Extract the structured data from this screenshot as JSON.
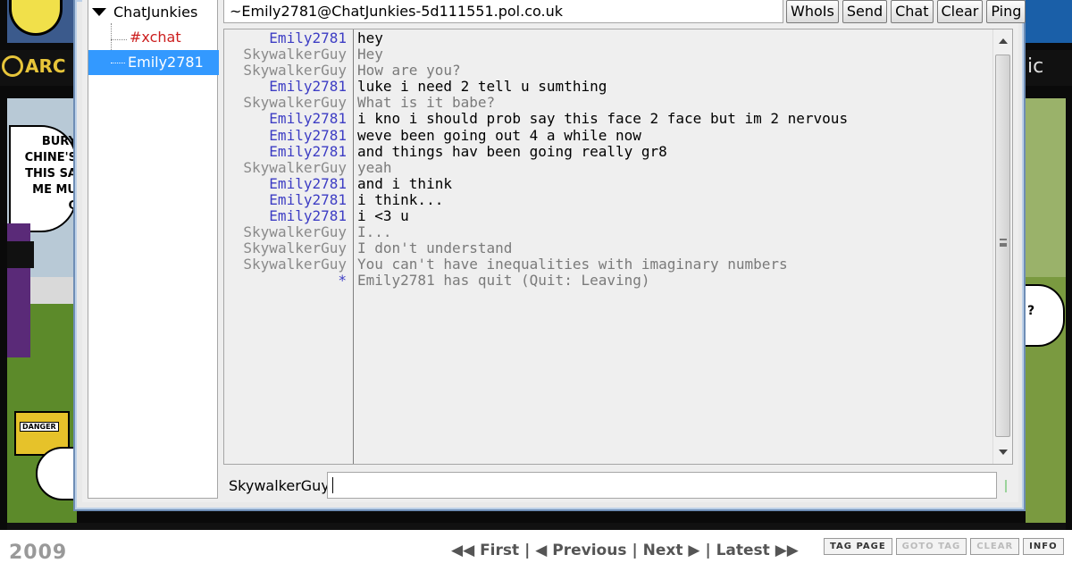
{
  "window": {
    "topic": "~Emily2781@ChatJunkies-5d111551.pol.co.uk",
    "buttons": [
      "WhoIs",
      "Send",
      "Chat",
      "Clear",
      "Ping"
    ]
  },
  "tree": {
    "server": "ChatJunkies",
    "channel": "#xchat",
    "query": "Emily2781"
  },
  "log": [
    {
      "nick": "Emily2781",
      "msg": "hey",
      "who": "emily"
    },
    {
      "nick": "SkywalkerGuy",
      "msg": "Hey",
      "who": "sky"
    },
    {
      "nick": "SkywalkerGuy",
      "msg": "How are you?",
      "who": "sky"
    },
    {
      "nick": "Emily2781",
      "msg": "luke i need 2 tell u sumthing",
      "who": "emily"
    },
    {
      "nick": "SkywalkerGuy",
      "msg": "What is it babe?",
      "who": "sky"
    },
    {
      "nick": "Emily2781",
      "msg": "i kno i should prob say this face 2 face but im 2 nervous",
      "who": "emily"
    },
    {
      "nick": "Emily2781",
      "msg": "weve been going out 4 a while now",
      "who": "emily"
    },
    {
      "nick": "Emily2781",
      "msg": "and things hav been going really gr8",
      "who": "emily"
    },
    {
      "nick": "SkywalkerGuy",
      "msg": "yeah",
      "who": "sky"
    },
    {
      "nick": "Emily2781",
      "msg": "and i think",
      "who": "emily"
    },
    {
      "nick": "Emily2781",
      "msg": "i think...",
      "who": "emily"
    },
    {
      "nick": "Emily2781",
      "msg": "i <3 u",
      "who": "emily"
    },
    {
      "nick": "SkywalkerGuy",
      "msg": "I...",
      "who": "sky"
    },
    {
      "nick": "SkywalkerGuy",
      "msg": "I don't understand",
      "who": "sky"
    },
    {
      "nick": "SkywalkerGuy",
      "msg": "You can't have inequalities with imaginary numbers",
      "who": "sky"
    },
    {
      "nick": "*",
      "msg": "Emily2781 has quit (Quit: Leaving)",
      "who": "sys"
    }
  ],
  "input": {
    "nick": "SkywalkerGuy",
    "value": ""
  },
  "background": {
    "left_top_text": "ARC",
    "bubble_left_lines": [
      "BURY",
      "CHINE'S",
      "THIS SA",
      "ME MU",
      "C"
    ],
    "right_top_text": "ic",
    "bubble_right_text": "?",
    "danger_label": "DANGER",
    "year": "2009",
    "nav": [
      "◀◀ First",
      "◀ Previous",
      "Next ▶",
      "Latest ▶▶"
    ],
    "tag_buttons": [
      "TAG PAGE",
      "GOTO TAG",
      "CLEAR",
      "INFO"
    ]
  },
  "colors": {
    "emily_nick": "#3d3dc4",
    "sky_nick": "#8a8a8a",
    "channel": "#cc1f1f",
    "selection": "#3399ff"
  }
}
